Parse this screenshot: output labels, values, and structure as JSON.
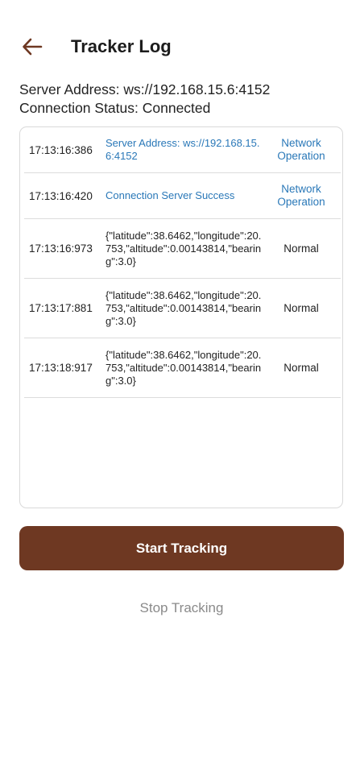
{
  "header": {
    "title": "Tracker Log",
    "back_icon": "arrow-left-icon",
    "accent_color": "#6e3822"
  },
  "info": {
    "server_address": "Server Address: ws://192.168.15.6:4152",
    "connection_status": "Connection Status: Connected"
  },
  "log": {
    "rows": [
      {
        "time": "17:13:16:386",
        "message": "Server Address: ws://192.168.15.6:4152",
        "type": "Network Operation"
      },
      {
        "time": "17:13:16:420",
        "message": "Connection Server Success",
        "type": "Network Operation"
      },
      {
        "time": "17:13:16:973",
        "message": "{\"latitude\":38.6462,\"longitude\":20.753,\"altitude\":0.00143814,\"bearing\":3.0}",
        "type": "Normal"
      },
      {
        "time": "17:13:17:881",
        "message": "{\"latitude\":38.6462,\"longitude\":20.753,\"altitude\":0.00143814,\"bearing\":3.0}",
        "type": "Normal"
      },
      {
        "time": "17:13:18:917",
        "message": "{\"latitude\":38.6462,\"longitude\":20.753,\"altitude\":0.00143814,\"bearing\":3.0}",
        "type": "Normal"
      }
    ]
  },
  "actions": {
    "start_label": "Start Tracking",
    "stop_label": "Stop Tracking"
  }
}
